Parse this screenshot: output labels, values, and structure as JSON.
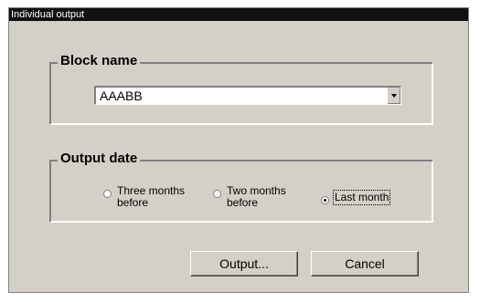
{
  "window": {
    "title": "Individual output"
  },
  "block_group": {
    "label": "Block name",
    "combo": {
      "value": "AAABB"
    }
  },
  "date_group": {
    "label": "Output date",
    "options": [
      {
        "line1": "Three months",
        "line2": "before",
        "selected": false
      },
      {
        "line1": "Two months",
        "line2": "before",
        "selected": false
      },
      {
        "line1": "Last month",
        "line2": "",
        "selected": true
      }
    ]
  },
  "buttons": {
    "output": "Output...",
    "cancel": "Cancel"
  },
  "icons": {
    "combo_arrow": "chevron-down-icon"
  }
}
